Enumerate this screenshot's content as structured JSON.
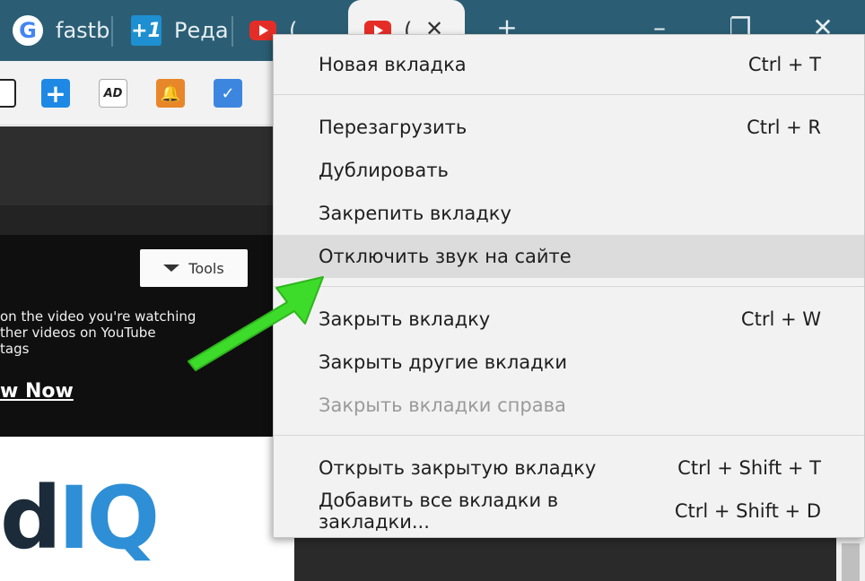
{
  "tabs": [
    {
      "label": "fastb",
      "icon": "google-icon"
    },
    {
      "label": "Реда",
      "icon": "plus-one-icon"
    },
    {
      "label": "(",
      "icon": "youtube-icon"
    },
    {
      "label": "(",
      "icon": "youtube-icon",
      "active": true
    }
  ],
  "window_controls": {
    "new_tab": "+",
    "minimize": "–",
    "restore": "❐",
    "close": "✕"
  },
  "page": {
    "tools_label": "Tools",
    "lines": [
      "on the video you're watching",
      "ther videos on YouTube",
      "tags"
    ],
    "watch_now": "w Now",
    "logo_d": "d",
    "logo_iq": "IQ"
  },
  "context_menu": {
    "items": [
      {
        "label": "Новая вкладка",
        "shortcut": "Ctrl + T"
      },
      {
        "label": "Перезагрузить",
        "shortcut": "Ctrl + R"
      },
      {
        "label": "Дублировать",
        "shortcut": ""
      },
      {
        "label": "Закрепить вкладку",
        "shortcut": ""
      },
      {
        "label": "Отключить звук на сайте",
        "shortcut": "",
        "highlighted": true
      },
      {
        "label": "Закрыть вкладку",
        "shortcut": "Ctrl + W"
      },
      {
        "label": "Закрыть другие вкладки",
        "shortcut": ""
      },
      {
        "label": "Закрыть вкладки справа",
        "shortcut": "",
        "disabled": true
      },
      {
        "label": "Открыть закрытую вкладку",
        "shortcut": "Ctrl + Shift + T"
      },
      {
        "label": "Добавить все вкладки в закладки...",
        "shortcut": "Ctrl + Shift + D"
      }
    ]
  },
  "colors": {
    "tabstrip": "#2b5e74",
    "menu_background": "#f2f2f2",
    "menu_highlight": "#dcdcdc",
    "arrow": "#3ddc2a",
    "youtube_red": "#e52d27"
  }
}
